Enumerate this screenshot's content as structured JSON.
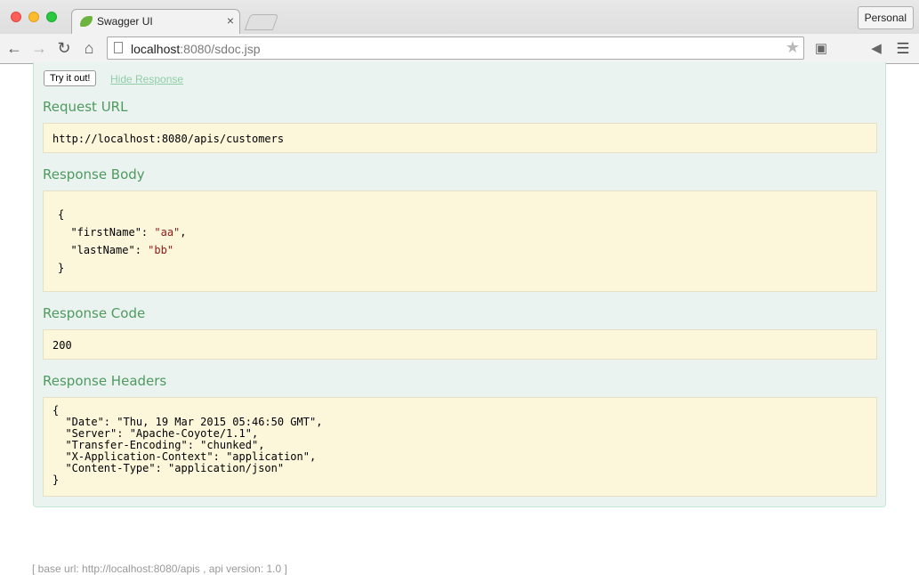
{
  "browser": {
    "tab_title": "Swagger UI",
    "tab_close": "×",
    "profile_label": "Personal",
    "url_host": "localhost",
    "url_rest": ":8080/sdoc.jsp"
  },
  "operation": {
    "try_button": "Try it out!",
    "hide_link": "Hide Response",
    "request_url_label": "Request URL",
    "request_url": "http://localhost:8080/apis/customers",
    "response_body_label": "Response Body",
    "response_body": {
      "open": "{",
      "line1_key": "  \"firstName\": ",
      "line1_val": "\"aa\"",
      "line1_end": ",",
      "line2_key": "  \"lastName\": ",
      "line2_val": "\"bb\"",
      "close": "}"
    },
    "response_code_label": "Response Code",
    "response_code": "200",
    "response_headers_label": "Response Headers",
    "response_headers": "{\n  \"Date\": \"Thu, 19 Mar 2015 05:46:50 GMT\",\n  \"Server\": \"Apache-Coyote/1.1\",\n  \"Transfer-Encoding\": \"chunked\",\n  \"X-Application-Context\": \"application\",\n  \"Content-Type\": \"application/json\"\n}"
  },
  "footer": {
    "text": "[ base url: http://localhost:8080/apis , api version: 1.0 ]"
  },
  "colors": {
    "section_label": "#4f9a60",
    "panel_bg": "#ebf3f0",
    "block_bg": "#fcf6db",
    "string_value": "#8b1a1a"
  },
  "icons": [
    "back-arrow-icon",
    "forward-arrow-icon",
    "reload-icon",
    "home-icon",
    "page-icon",
    "star-icon",
    "cast-icon",
    "hangouts-icon",
    "audio-icon",
    "menu-icon"
  ]
}
